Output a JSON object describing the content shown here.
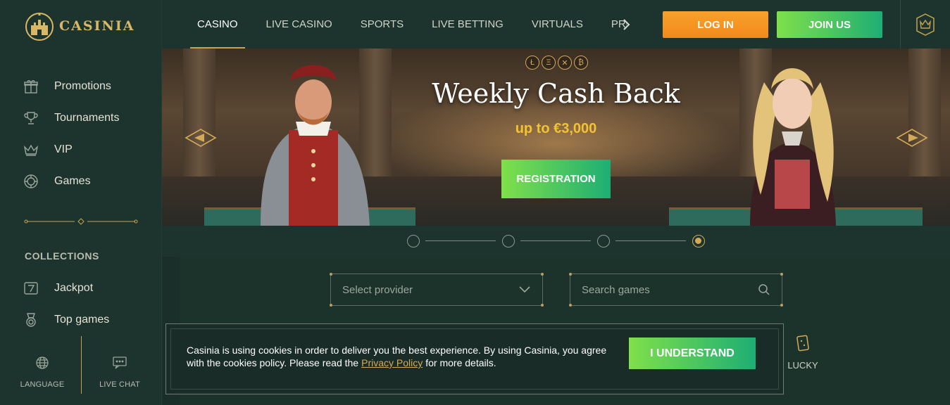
{
  "brand": {
    "name": "CASINIA"
  },
  "sidebar": {
    "items": [
      {
        "label": "Promotions",
        "icon": "gift-icon"
      },
      {
        "label": "Tournaments",
        "icon": "trophy-icon"
      },
      {
        "label": "VIP",
        "icon": "crown-icon"
      },
      {
        "label": "Games",
        "icon": "chip-icon"
      }
    ],
    "collections_title": "COLLECTIONS",
    "collections": [
      {
        "label": "Jackpot",
        "icon": "seven-icon"
      },
      {
        "label": "Top games",
        "icon": "medal-icon"
      }
    ],
    "bottom": {
      "language": "LANGUAGE",
      "live_chat": "LIVE CHAT"
    }
  },
  "topnav": {
    "tabs": [
      "CASINO",
      "LIVE CASINO",
      "SPORTS",
      "LIVE BETTING",
      "VIRTUALS",
      "PROMOTIONS"
    ],
    "active_tab": "CASINO",
    "login_label": "LOG IN",
    "join_label": "JOIN US"
  },
  "banner": {
    "coins": [
      "Ł",
      "Ξ",
      "✕",
      "₿"
    ],
    "title": "Weekly Cash Back",
    "subtitle": "up to €3,000",
    "cta": "REGISTRATION",
    "slide_count": 4,
    "active_slide": 4
  },
  "filters": {
    "provider_placeholder": "Select provider",
    "search_placeholder": "Search games"
  },
  "lucky": {
    "label": "LUCKY"
  },
  "cookie": {
    "text_before": "Casinia is using cookies in order to deliver you the best experience. By using Casinia, you agree with the cookies policy. Please read the",
    "link": "Privacy Policy",
    "text_after": "for more details.",
    "button": "I UNDERSTAND"
  },
  "colors": {
    "gold": "#d3aa58",
    "green_accent": "#1eae74",
    "orange": "#f38a1a",
    "bg": "#1c342d"
  }
}
